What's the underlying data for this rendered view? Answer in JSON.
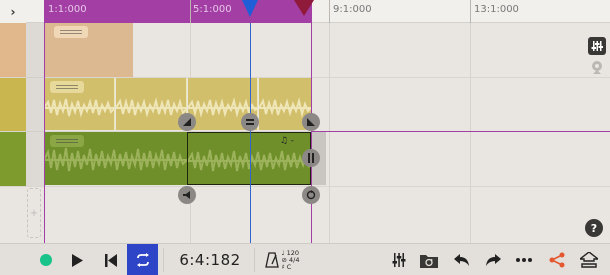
{
  "ruler": {
    "collapse_icon": "chevron-right-icon",
    "bar_labels": [
      "1:1:000",
      "5:1:000",
      "9:1:000",
      "13:1:000"
    ]
  },
  "tracks": [
    {
      "name": "track-1",
      "color": "#ddb992",
      "header_color": "#e0b88b"
    },
    {
      "name": "track-2",
      "color": "#d4c06a",
      "header_color": "#c9b64e"
    },
    {
      "name": "track-3",
      "color": "#6f8f2a",
      "header_color": "#7e9c2e"
    }
  ],
  "handles": {
    "split_icon": "equals-icon",
    "fade_in_icon": "fade-in-icon",
    "fade_out_icon": "fade-out-icon",
    "resize_icon": "resize-handle-icon",
    "volume_icon": "speaker-icon",
    "loop_icon": "loop-icon"
  },
  "clip_badge": "♫ -",
  "bottom_bar": {
    "time": "6:4:182",
    "tempo": "120",
    "time_signature": "4/4",
    "key": "C",
    "icons": [
      "record-icon",
      "play-icon",
      "skip-to-start-icon",
      "loop-icon",
      "metronome-icon",
      "mixer-icon",
      "folder-loop-icon",
      "undo-icon",
      "redo-icon",
      "more-icon",
      "share-icon",
      "export-icon"
    ]
  },
  "help_label": "?",
  "colors": {
    "loop_region": "#a23ea4",
    "playhead": "#1f5ed6",
    "accent_blue": "#2f45c8",
    "record": "#19c38a",
    "share": "#e4572e"
  }
}
